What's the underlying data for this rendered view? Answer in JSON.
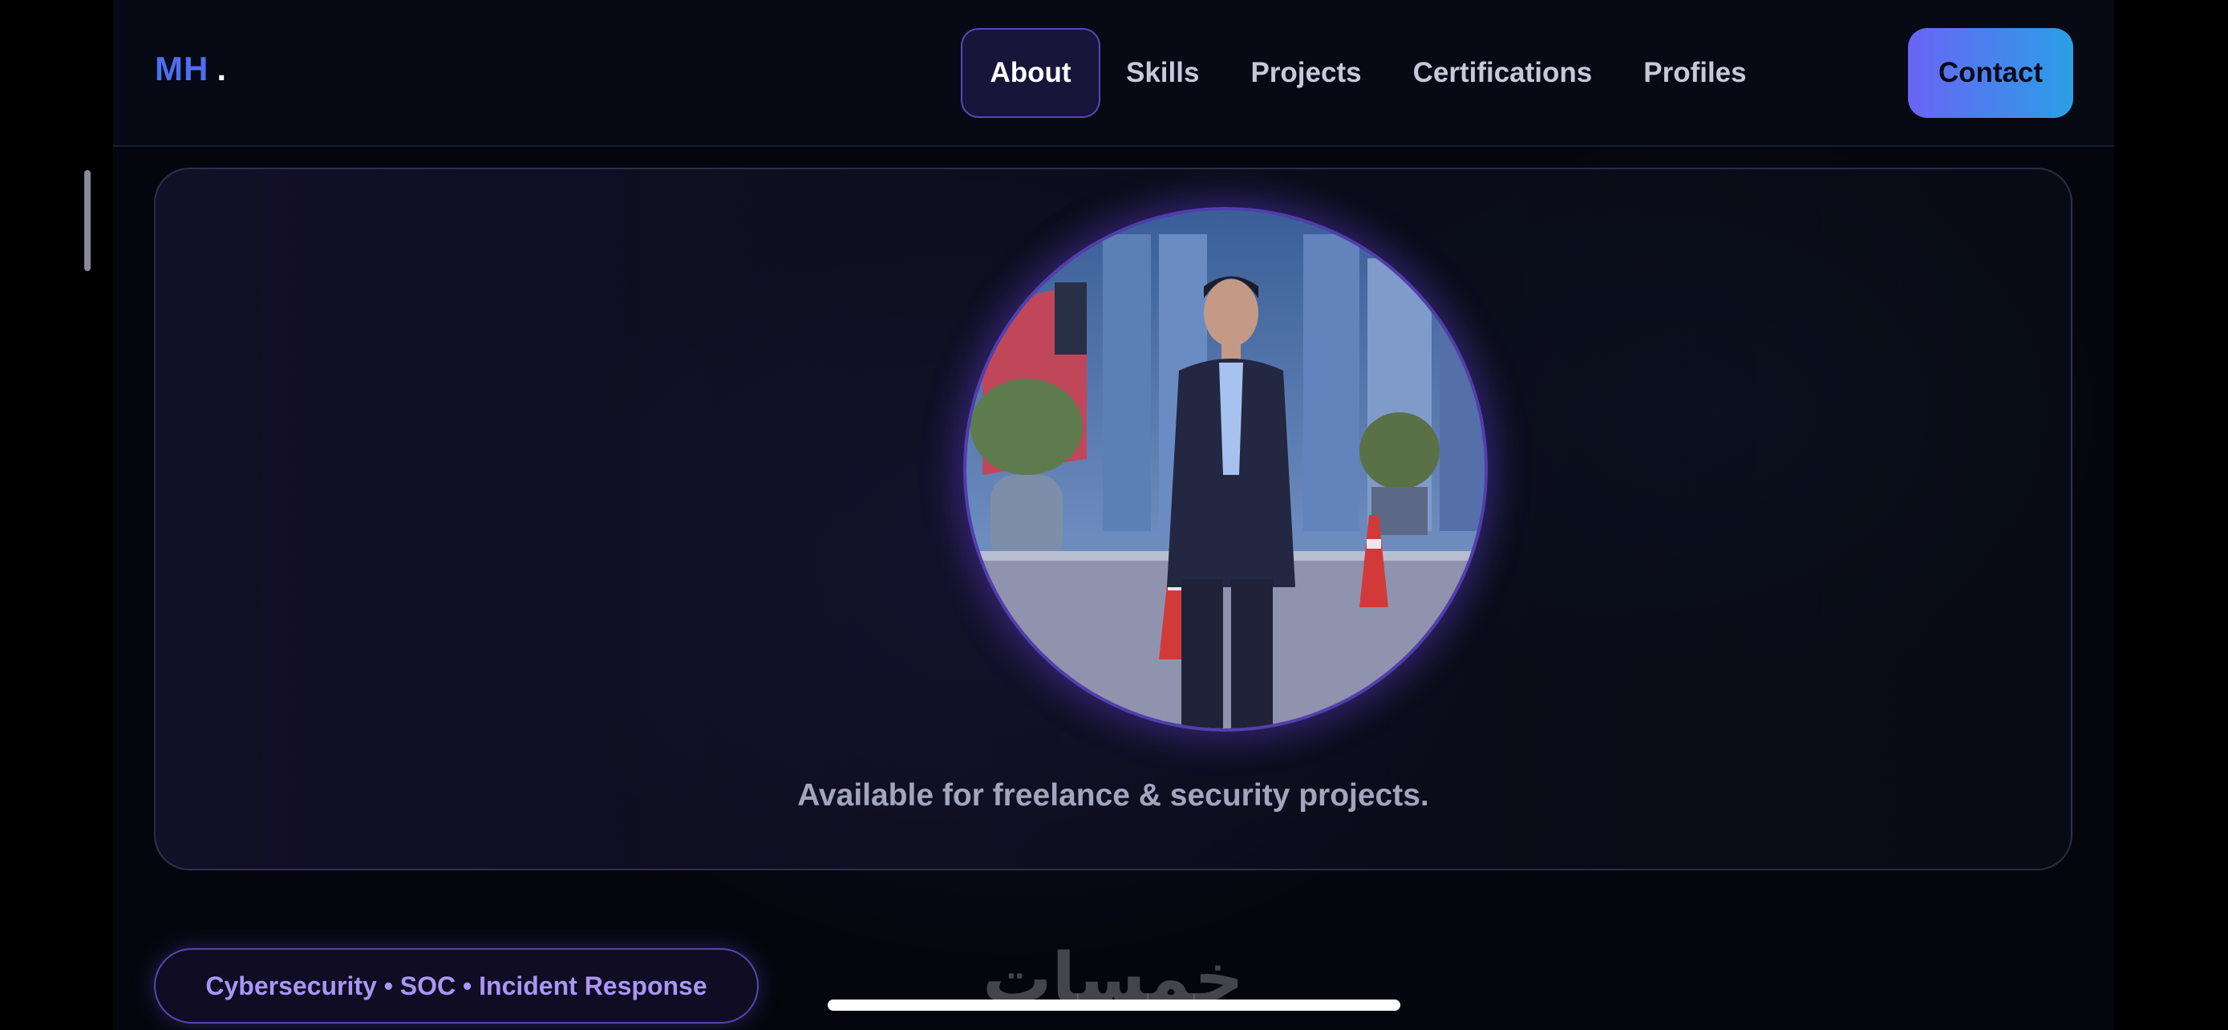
{
  "brand": {
    "logo_text": "MH",
    "logo_dot": "."
  },
  "nav": {
    "items": [
      {
        "label": "About",
        "active": true
      },
      {
        "label": "Skills"
      },
      {
        "label": "Projects"
      },
      {
        "label": "Certifications"
      },
      {
        "label": "Profiles"
      }
    ],
    "contact_label": "Contact"
  },
  "hero": {
    "caption": "Available for freelance & security projects."
  },
  "tagline": "Cybersecurity • SOC • Incident Response",
  "watermark_text": "خمسات",
  "colors": {
    "accent": "#6a64f5",
    "accent_2": "#2a9fe6",
    "logo": "#4f6ff2",
    "background": "#05060d",
    "pill_text": "#a996f5"
  }
}
